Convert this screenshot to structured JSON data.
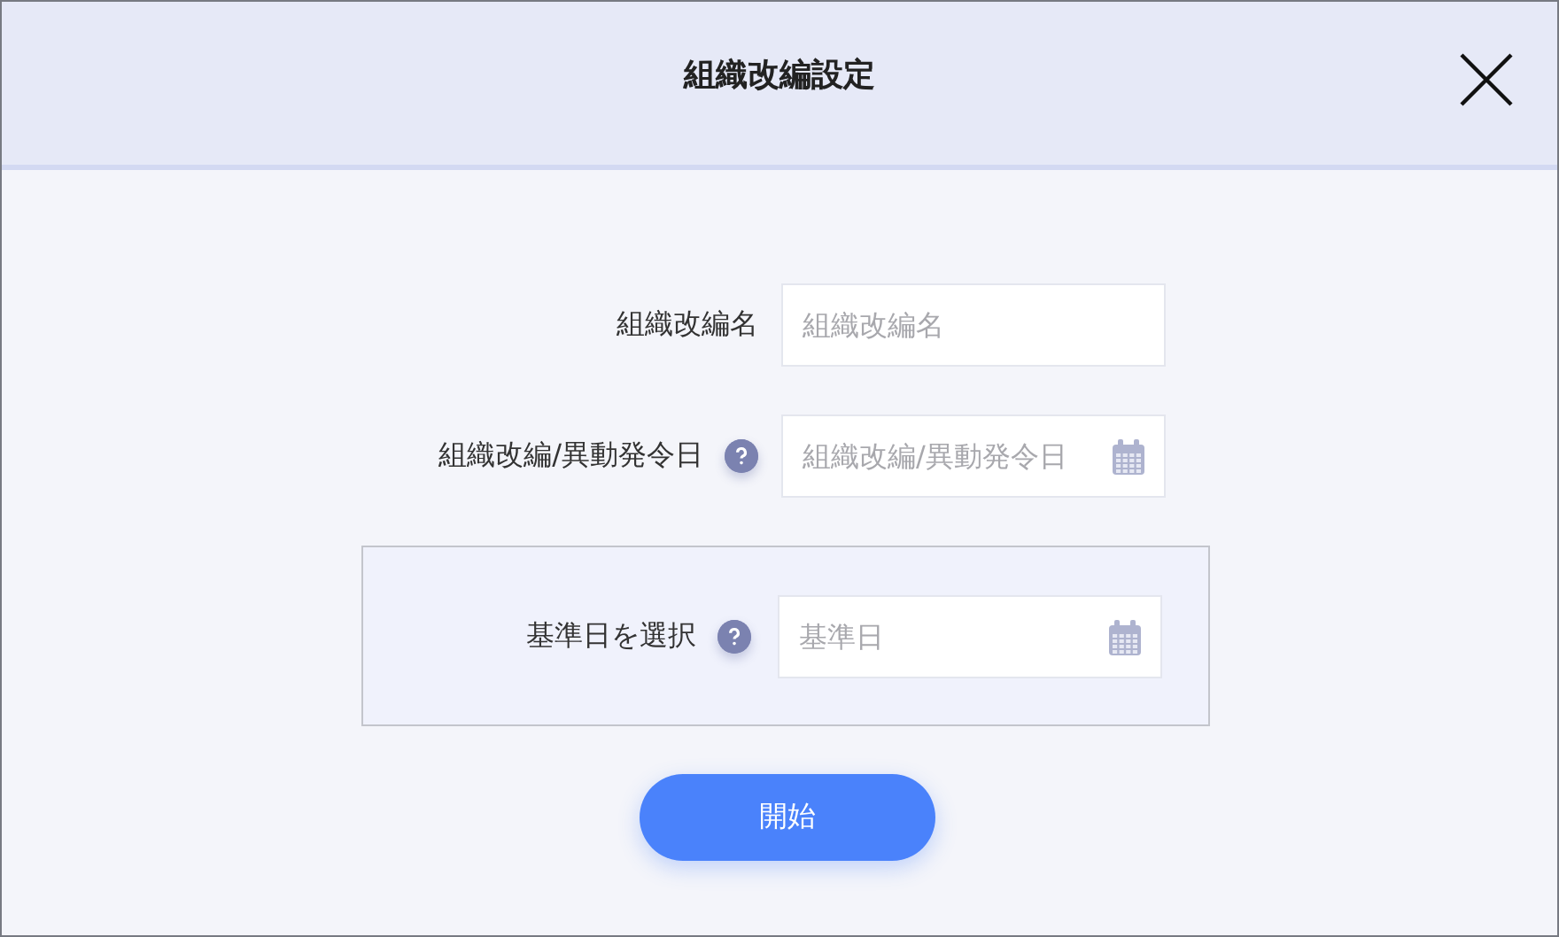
{
  "dialog": {
    "title": "組織改編設定"
  },
  "fields": [
    {
      "label": "組織改編名",
      "placeholder": "組織改編名",
      "kind": "text",
      "help": false
    },
    {
      "label": "組織改編/異動発令日",
      "placeholder": "組織改編/異動発令日",
      "kind": "date",
      "help": true
    }
  ],
  "base_date_panel": {
    "label": "基準日を選択",
    "placeholder": "基準日",
    "kind": "date",
    "help": true
  },
  "start_button": {
    "label": "開始"
  }
}
